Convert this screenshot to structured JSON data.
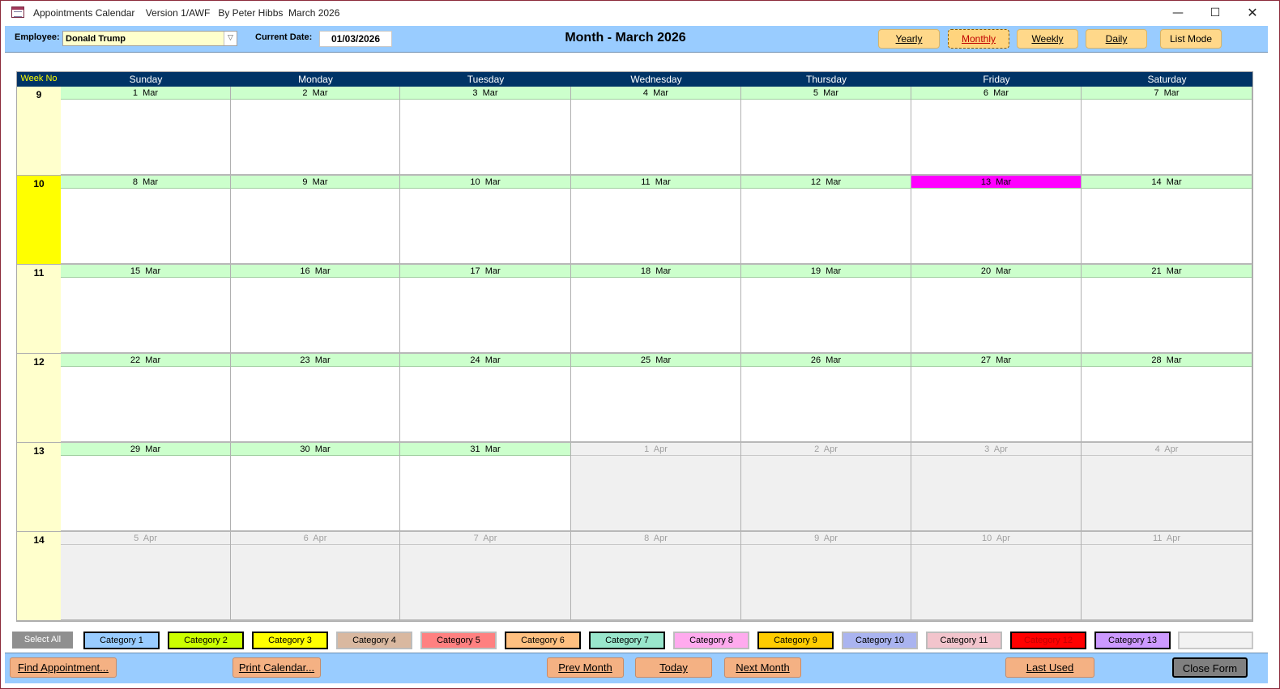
{
  "window": {
    "title": "Appointments Calendar    Version 1/AWF   By Peter Hibbs  March 2026",
    "minimize_glyph": "—",
    "maximize_glyph": "☐",
    "close_glyph": "✕"
  },
  "header": {
    "employee_label": "Employee:",
    "employee_value": "Donald Trump",
    "dropdown_glyph": "▽",
    "date_label": "Current Date:",
    "current_date": "01/03/2026",
    "month_title": "Month - March 2026",
    "views": [
      {
        "label": "Yearly",
        "active": false
      },
      {
        "label": "Monthly",
        "active": true
      },
      {
        "label": "Weekly",
        "active": false
      },
      {
        "label": "Daily",
        "active": false
      },
      {
        "label": "List Mode",
        "active": false
      }
    ]
  },
  "calendar": {
    "weekno_header": "Week No",
    "day_names": [
      "Sunday",
      "Monday",
      "Tuesday",
      "Wednesday",
      "Thursday",
      "Friday",
      "Saturday"
    ],
    "weeks": [
      {
        "number": "9",
        "current": false,
        "days": [
          {
            "day": "1",
            "month": "Mar",
            "in_month": true,
            "today": false
          },
          {
            "day": "2",
            "month": "Mar",
            "in_month": true,
            "today": false
          },
          {
            "day": "3",
            "month": "Mar",
            "in_month": true,
            "today": false
          },
          {
            "day": "4",
            "month": "Mar",
            "in_month": true,
            "today": false
          },
          {
            "day": "5",
            "month": "Mar",
            "in_month": true,
            "today": false
          },
          {
            "day": "6",
            "month": "Mar",
            "in_month": true,
            "today": false
          },
          {
            "day": "7",
            "month": "Mar",
            "in_month": true,
            "today": false
          }
        ]
      },
      {
        "number": "10",
        "current": true,
        "days": [
          {
            "day": "8",
            "month": "Mar",
            "in_month": true,
            "today": false
          },
          {
            "day": "9",
            "month": "Mar",
            "in_month": true,
            "today": false
          },
          {
            "day": "10",
            "month": "Mar",
            "in_month": true,
            "today": false
          },
          {
            "day": "11",
            "month": "Mar",
            "in_month": true,
            "today": false
          },
          {
            "day": "12",
            "month": "Mar",
            "in_month": true,
            "today": false
          },
          {
            "day": "13",
            "month": "Mar",
            "in_month": true,
            "today": true
          },
          {
            "day": "14",
            "month": "Mar",
            "in_month": true,
            "today": false
          }
        ]
      },
      {
        "number": "11",
        "current": false,
        "days": [
          {
            "day": "15",
            "month": "Mar",
            "in_month": true,
            "today": false
          },
          {
            "day": "16",
            "month": "Mar",
            "in_month": true,
            "today": false
          },
          {
            "day": "17",
            "month": "Mar",
            "in_month": true,
            "today": false
          },
          {
            "day": "18",
            "month": "Mar",
            "in_month": true,
            "today": false
          },
          {
            "day": "19",
            "month": "Mar",
            "in_month": true,
            "today": false
          },
          {
            "day": "20",
            "month": "Mar",
            "in_month": true,
            "today": false
          },
          {
            "day": "21",
            "month": "Mar",
            "in_month": true,
            "today": false
          }
        ]
      },
      {
        "number": "12",
        "current": false,
        "days": [
          {
            "day": "22",
            "month": "Mar",
            "in_month": true,
            "today": false
          },
          {
            "day": "23",
            "month": "Mar",
            "in_month": true,
            "today": false
          },
          {
            "day": "24",
            "month": "Mar",
            "in_month": true,
            "today": false
          },
          {
            "day": "25",
            "month": "Mar",
            "in_month": true,
            "today": false
          },
          {
            "day": "26",
            "month": "Mar",
            "in_month": true,
            "today": false
          },
          {
            "day": "27",
            "month": "Mar",
            "in_month": true,
            "today": false
          },
          {
            "day": "28",
            "month": "Mar",
            "in_month": true,
            "today": false
          }
        ]
      },
      {
        "number": "13",
        "current": false,
        "days": [
          {
            "day": "29",
            "month": "Mar",
            "in_month": true,
            "today": false
          },
          {
            "day": "30",
            "month": "Mar",
            "in_month": true,
            "today": false
          },
          {
            "day": "31",
            "month": "Mar",
            "in_month": true,
            "today": false
          },
          {
            "day": "1",
            "month": "Apr",
            "in_month": false,
            "today": false
          },
          {
            "day": "2",
            "month": "Apr",
            "in_month": false,
            "today": false
          },
          {
            "day": "3",
            "month": "Apr",
            "in_month": false,
            "today": false
          },
          {
            "day": "4",
            "month": "Apr",
            "in_month": false,
            "today": false
          }
        ]
      },
      {
        "number": "14",
        "current": false,
        "days": [
          {
            "day": "5",
            "month": "Apr",
            "in_month": false,
            "today": false
          },
          {
            "day": "6",
            "month": "Apr",
            "in_month": false,
            "today": false
          },
          {
            "day": "7",
            "month": "Apr",
            "in_month": false,
            "today": false
          },
          {
            "day": "8",
            "month": "Apr",
            "in_month": false,
            "today": false
          },
          {
            "day": "9",
            "month": "Apr",
            "in_month": false,
            "today": false
          },
          {
            "day": "10",
            "month": "Apr",
            "in_month": false,
            "today": false
          },
          {
            "day": "11",
            "month": "Apr",
            "in_month": false,
            "today": false
          }
        ]
      }
    ]
  },
  "categories": {
    "select_all": "Select All",
    "items": [
      {
        "label": "Category 1",
        "color": "#99ccff",
        "text_color": "#000000",
        "outlined": true
      },
      {
        "label": "Category 2",
        "color": "#ccff00",
        "text_color": "#000000",
        "outlined": true
      },
      {
        "label": "Category 3",
        "color": "#ffff00",
        "text_color": "#000000",
        "outlined": true
      },
      {
        "label": "Category 4",
        "color": "#d9b8a0",
        "text_color": "#000000",
        "outlined": false
      },
      {
        "label": "Category 5",
        "color": "#ff8080",
        "text_color": "#000000",
        "outlined": false
      },
      {
        "label": "Category 6",
        "color": "#ffc080",
        "text_color": "#000000",
        "outlined": true
      },
      {
        "label": "Category 7",
        "color": "#99e6cc",
        "text_color": "#000000",
        "outlined": true
      },
      {
        "label": "Category 8",
        "color": "#ffaaee",
        "text_color": "#000000",
        "outlined": false
      },
      {
        "label": "Category 9",
        "color": "#ffcc00",
        "text_color": "#000000",
        "outlined": true
      },
      {
        "label": "Category 10",
        "color": "#aab4f0",
        "text_color": "#000000",
        "outlined": false
      },
      {
        "label": "Category 11",
        "color": "#f2c4cc",
        "text_color": "#000000",
        "outlined": false
      },
      {
        "label": "Category 12",
        "color": "#ff0000",
        "text_color": "#c00000",
        "outlined": true
      },
      {
        "label": "Category 13",
        "color": "#cc99ff",
        "text_color": "#000000",
        "outlined": true
      }
    ]
  },
  "footer": {
    "find": "Find Appointment...",
    "print": "Print Calendar...",
    "prev": "Prev Month",
    "today": "Today",
    "next": "Next Month",
    "last_used": "Last Used",
    "close": "Close Form"
  }
}
